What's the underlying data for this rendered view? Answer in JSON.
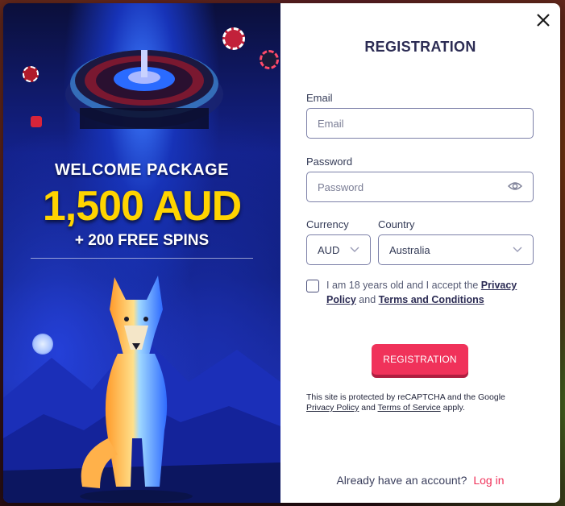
{
  "promo": {
    "welcome": "WELCOME PACKAGE",
    "amount": "1,500 AUD",
    "spins": "+ 200 FREE SPINS"
  },
  "form": {
    "title": "REGISTRATION",
    "email_label": "Email",
    "email_placeholder": "Email",
    "password_label": "Password",
    "password_placeholder": "Password",
    "currency_label": "Currency",
    "currency_value": "AUD",
    "country_label": "Country",
    "country_value": "Australia",
    "consent_prefix": "I am 18 years old and I accept the ",
    "privacy_link": "Privacy Policy",
    "consent_and": " and ",
    "terms_link": "Terms and Conditions",
    "register_button": "REGISTRATION",
    "recaptcha_text": "This site is protected by reCAPTCHA and the Google",
    "recaptcha_privacy": "Privacy Policy",
    "recaptcha_and": " and ",
    "recaptcha_terms": "Terms of Service",
    "recaptcha_suffix": " apply.",
    "have_account": "Already have an account?",
    "login_link": "Log in"
  },
  "icons": [
    "close-icon",
    "eye-icon",
    "chevron-down-icon"
  ],
  "colors": {
    "accent": "#f0325a",
    "title": "#2c2c54",
    "promo_amount": "#ffd400"
  }
}
